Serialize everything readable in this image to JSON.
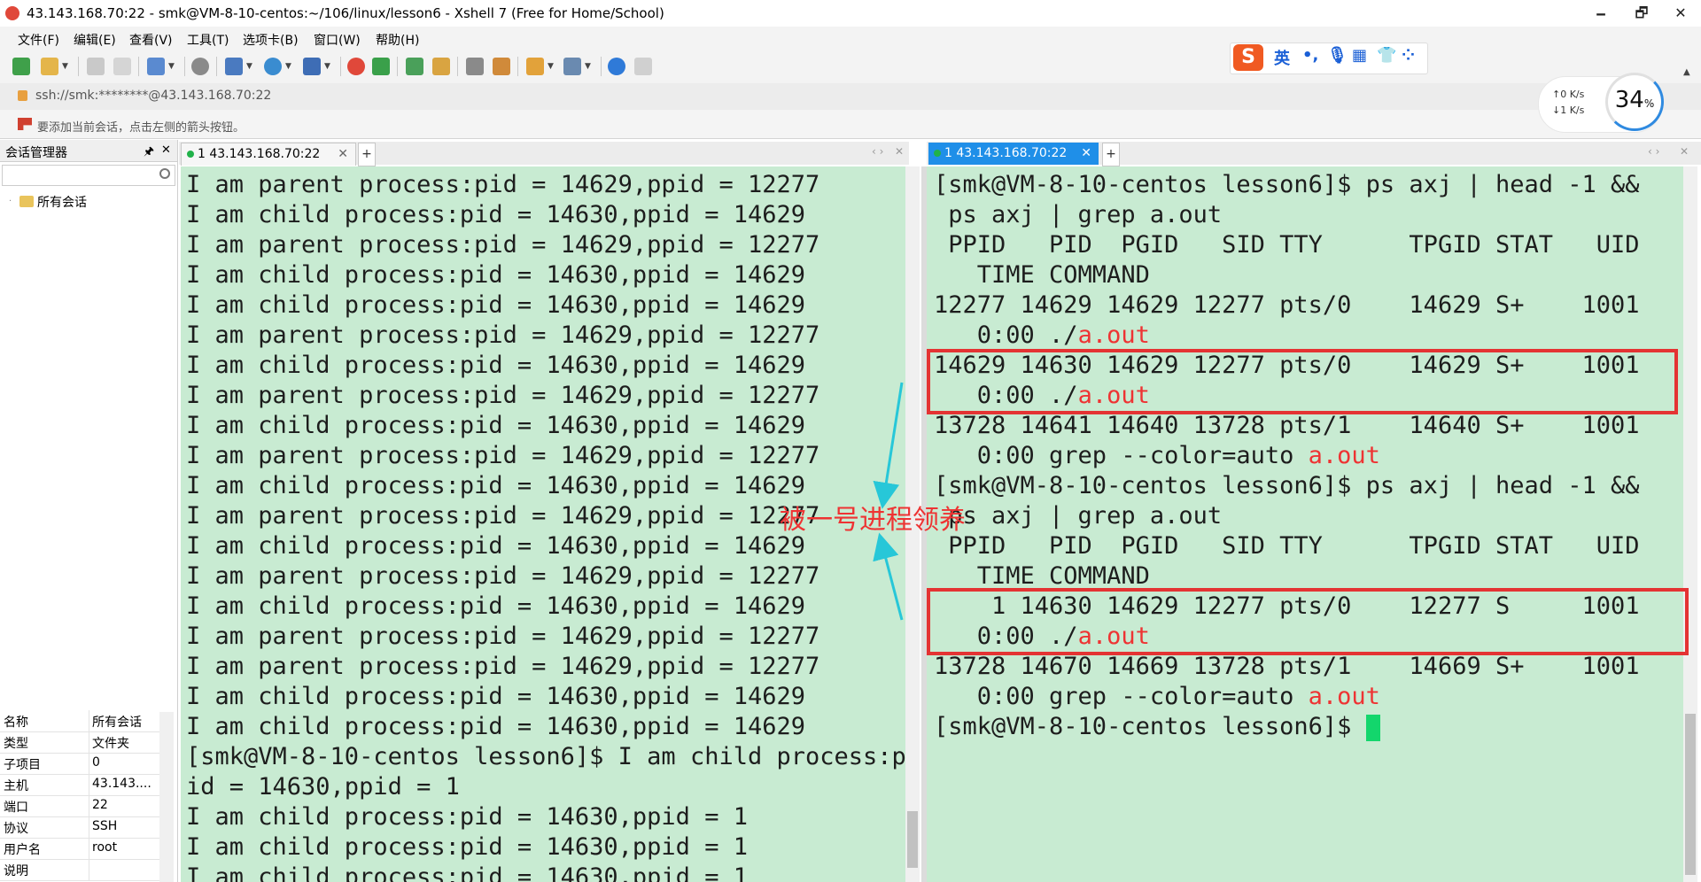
{
  "window": {
    "title": "43.143.168.70:22 - smk@VM-8-10-centos:~/106/linux/lesson6 - Xshell 7 (Free for Home/School)",
    "minimize": "🗕",
    "maximize": "🗗",
    "close": "✕"
  },
  "menu": [
    "文件(F)",
    "编辑(E)",
    "查看(V)",
    "工具(T)",
    "选项卡(B)",
    "窗口(W)",
    "帮助(H)"
  ],
  "ime": {
    "logo": "S",
    "lang": "英",
    "punct": "•,",
    "mic": "🎙",
    "keyboard": "▦",
    "skin": "👕",
    "apps": "⁘"
  },
  "address": "ssh://smk:********@43.143.168.70:22",
  "hint": "要添加当前会话，点击左侧的箭头按钮。",
  "speed": {
    "up": "↑0  K/s",
    "down": "↓1  K/s",
    "percent": "34",
    "percent_unit": "%"
  },
  "session_manager": {
    "title": "会话管理器",
    "pin": "🖈",
    "close": "✕",
    "tree_root": "所有会话",
    "properties": [
      {
        "key": "名称",
        "value": "所有会话"
      },
      {
        "key": "类型",
        "value": "文件夹"
      },
      {
        "key": "子项目",
        "value": "0"
      },
      {
        "key": "主机",
        "value": "43.143...."
      },
      {
        "key": "端口",
        "value": "22"
      },
      {
        "key": "协议",
        "value": "SSH"
      },
      {
        "key": "用户名",
        "value": "root"
      },
      {
        "key": "说明",
        "value": ""
      }
    ]
  },
  "left_tab": {
    "label": "1 43.143.168.70:22",
    "close": "✕",
    "add": "+"
  },
  "right_tab": {
    "label": "1 43.143.168.70:22",
    "close": "✕",
    "add": "+"
  },
  "left_terminal": [
    "I am parent process:pid = 14629,ppid = 12277",
    "I am child process:pid = 14630,ppid = 14629",
    "I am parent process:pid = 14629,ppid = 12277",
    "I am child process:pid = 14630,ppid = 14629",
    "I am child process:pid = 14630,ppid = 14629",
    "I am parent process:pid = 14629,ppid = 12277",
    "I am child process:pid = 14630,ppid = 14629",
    "I am parent process:pid = 14629,ppid = 12277",
    "I am child process:pid = 14630,ppid = 14629",
    "I am parent process:pid = 14629,ppid = 12277",
    "I am child process:pid = 14630,ppid = 14629",
    "I am parent process:pid = 14629,ppid = 12277",
    "I am child process:pid = 14630,ppid = 14629",
    "I am parent process:pid = 14629,ppid = 12277",
    "I am child process:pid = 14630,ppid = 14629",
    "I am parent process:pid = 14629,ppid = 12277",
    "I am parent process:pid = 14629,ppid = 12277",
    "I am child process:pid = 14630,ppid = 14629",
    "I am child process:pid = 14630,ppid = 14629",
    "[smk@VM-8-10-centos lesson6]$ I am child process:p",
    "id = 14630,ppid = 1",
    "I am child process:pid = 14630,ppid = 1",
    "I am child process:pid = 14630,ppid = 1",
    "I am child process:pid = 14630,ppid = 1"
  ],
  "right_terminal": [
    {
      "text": "[smk@VM-8-10-centos lesson6]$ ps axj | head -1 &&",
      "red": ""
    },
    {
      "text": " ps axj | grep a.out",
      "red": ""
    },
    {
      "text": " PPID   PID  PGID   SID TTY      TPGID STAT   UID",
      "red": ""
    },
    {
      "text": "   TIME COMMAND",
      "red": ""
    },
    {
      "text": "12277 14629 14629 12277 pts/0    14629 S+    1001",
      "red": ""
    },
    {
      "text": "   0:00 ./",
      "red": "a.out"
    },
    {
      "text": "14629 14630 14629 12277 pts/0    14629 S+    1001",
      "red": ""
    },
    {
      "text": "   0:00 ./",
      "red": "a.out"
    },
    {
      "text": "13728 14641 14640 13728 pts/1    14640 S+    1001",
      "red": ""
    },
    {
      "text": "   0:00 grep --color=auto ",
      "red": "a.out"
    },
    {
      "text": "[smk@VM-8-10-centos lesson6]$ ps axj | head -1 &&",
      "red": ""
    },
    {
      "text": " ps axj | grep a.out",
      "red": ""
    },
    {
      "text": " PPID   PID  PGID   SID TTY      TPGID STAT   UID",
      "red": ""
    },
    {
      "text": "   TIME COMMAND",
      "red": ""
    },
    {
      "text": "    1 14630 14629 12277 pts/0    12277 S     1001",
      "red": ""
    },
    {
      "text": "   0:00 ./",
      "red": "a.out"
    },
    {
      "text": "13728 14670 14669 13728 pts/1    14669 S+    1001",
      "red": ""
    },
    {
      "text": "   0:00 grep --color=auto ",
      "red": "a.out"
    },
    {
      "text": "[smk@VM-8-10-centos lesson6]$ ",
      "red": ""
    }
  ],
  "annotation": "被一号进程领养",
  "colors": {
    "terminal_bg": "#c8ebd2",
    "highlight_red": "#ee3333",
    "arrow": "#27c7d8",
    "cursor": "#13d66c"
  }
}
